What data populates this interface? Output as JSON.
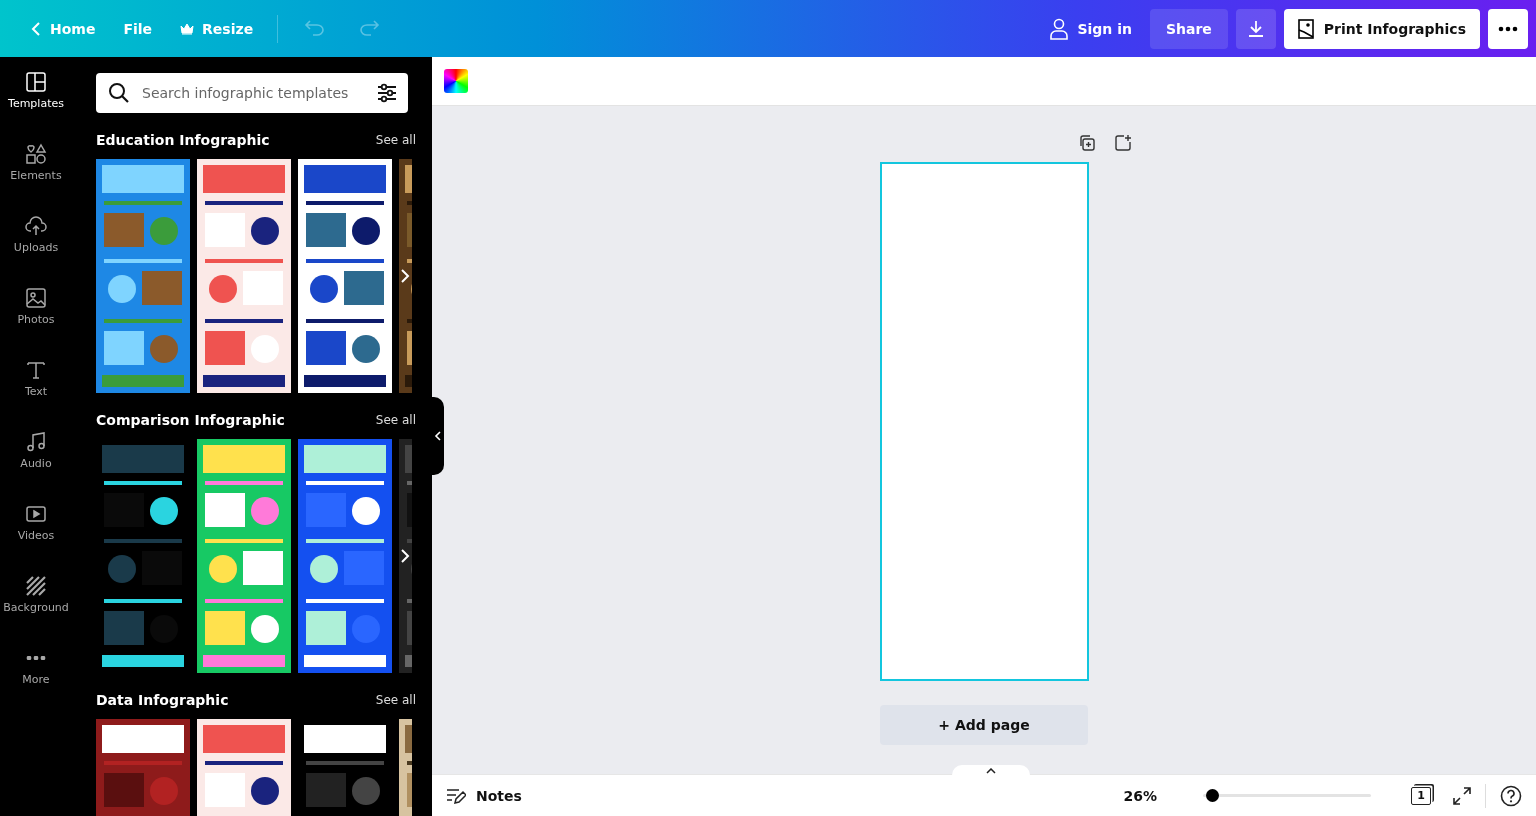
{
  "top_bar": {
    "nav": [
      {
        "label": "Home",
        "kind": "back"
      },
      {
        "label": "File",
        "kind": "plain"
      },
      {
        "label": "Resize",
        "kind": "crown"
      }
    ],
    "history": [
      {
        "kind": "undo",
        "disabled": true
      },
      {
        "kind": "redo",
        "disabled": true
      }
    ],
    "sign_in": "Sign in",
    "share": "Share",
    "print_button": "Print Infographics"
  },
  "rail": [
    {
      "label": "Templates",
      "kind": "templates",
      "selected": true
    },
    {
      "label": "Elements",
      "kind": "elements",
      "selected": false
    },
    {
      "label": "Uploads",
      "kind": "uploads",
      "selected": false
    },
    {
      "label": "Photos",
      "kind": "photos",
      "selected": false
    },
    {
      "label": "Text",
      "kind": "text",
      "selected": false
    },
    {
      "label": "Audio",
      "kind": "audio",
      "selected": false
    },
    {
      "label": "Videos",
      "kind": "videos",
      "selected": false
    },
    {
      "label": "Background",
      "kind": "background",
      "selected": false
    },
    {
      "label": "More",
      "kind": "more",
      "selected": false
    }
  ],
  "search": {
    "placeholder": "Search infographic templates"
  },
  "sections": [
    {
      "title": "Education Infographic",
      "see_all": "See all",
      "next_arrow": true
    },
    {
      "title": "Comparison Infographic",
      "see_all": "See all",
      "next_arrow": true
    },
    {
      "title": "Data Infographic",
      "see_all": "See all"
    }
  ],
  "add_page": "+ Add page",
  "footer": {
    "notes": "Notes",
    "zoom_reading": "26%",
    "zoom_slider": {
      "level": 0.02
    },
    "page_count": "1"
  }
}
